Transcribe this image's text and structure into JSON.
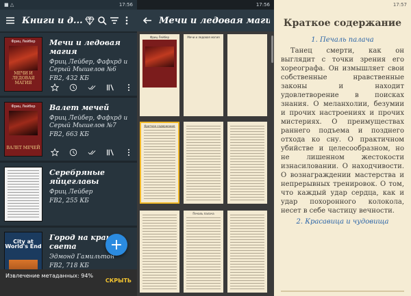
{
  "panel1": {
    "status": {
      "left": "■ △",
      "right": "17:56"
    },
    "appbar": {
      "title": "Книги и д..."
    },
    "books": [
      {
        "title": "Мечи и ледовая магия",
        "author": "Фриц Лейбер, Фафхрд и Серый Мышелов №6",
        "meta": "FB2, 432 КБ",
        "cover_author": "Фриц Лейбер",
        "cover_title": "МЕЧИ И ЛЕДОВАЯ МАГИЯ"
      },
      {
        "title": "Валет мечей",
        "author": "Фриц Лейбер, Фафхрд и Серый Мышелов №7",
        "meta": "FB2, 663 КБ",
        "cover_author": "Фриц Лейбер",
        "cover_title": "ВАЛЕТ МЕЧЕЙ"
      },
      {
        "title": "Серебряные яйцеглавы",
        "author": "Фриц Лейбер",
        "meta": "FB2, 255 КБ"
      },
      {
        "title": "Город на краю света",
        "author": "Эдмонд Гамильтон",
        "meta": "FB2, 718 КБ",
        "cover_title": "City at World's End"
      }
    ],
    "snackbar": {
      "text": "Извлечение метаданных: 94%",
      "action": "СКРЫТЬ"
    },
    "fab": "+"
  },
  "panel2": {
    "status": {
      "left": "",
      "right": "17:56"
    },
    "appbar": {
      "title": "Мечи и ледовая магия"
    },
    "page_header_cover": "Фриц Лейбер",
    "page_header_title": "Мечи и ледовая магия",
    "page_header_toc": "Краткое содержание",
    "page_header_chapter": "Печаль палача"
  },
  "panel3": {
    "status": {
      "left": "",
      "right": "17:57"
    },
    "heading": "Краткое содержание",
    "sections": [
      "1. Печаль палача",
      "2. Красавица и чудовища"
    ],
    "paragraph": "Танец смерти, как он выглядит с точки зрения его хореографа. Он измышляет свои собственные нравственные законы и находит удовлетворение в поисках знания. О меланхолии, безумии и прочих настроениях и прочих мистериях. О преимуществах раннего подъема и позднего отхода ко сну. О практичном убийстве и целесообразном, но не лишенном жестокости изнасиловании. О находчивости. О вознаграждении мастерства и непрерывных тренировок. О том, что каждый удар сердца, как и удар похоронного колокола, несет в себе частицу вечности."
  },
  "colors": {
    "accent": "#2b8be0",
    "selection": "#f1b726",
    "link": "#2b65a8",
    "snack_action": "#f4c430"
  }
}
